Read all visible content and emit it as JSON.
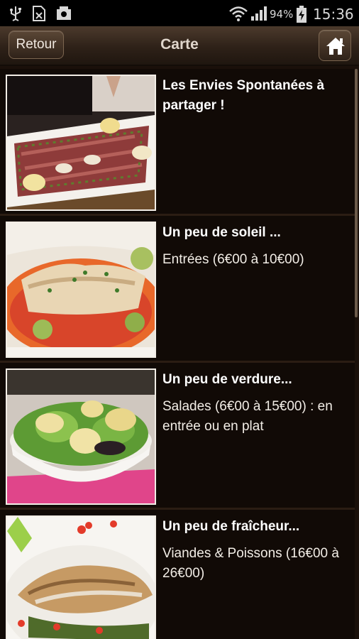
{
  "statusbar": {
    "battery": "94%",
    "time": "15:36"
  },
  "header": {
    "back_label": "Retour",
    "title": "Carte",
    "home_icon": "home-icon"
  },
  "menu": {
    "items": [
      {
        "title": "Les Envies Spontanées à partager !",
        "description": "",
        "image": "carpaccio-plate"
      },
      {
        "title": "Un peu de soleil ...",
        "description": "Entrées (6€00 à 10€00)",
        "image": "fish-vegetables-plate"
      },
      {
        "title": "Un peu de verdure...",
        "description": "Salades (6€00 à 15€00) : en entrée ou en plat",
        "image": "salad-bowl"
      },
      {
        "title": "Un peu de fraîcheur...",
        "description": "Viandes & Poissons (16€00 à 26€00)",
        "image": "grilled-fish-plate"
      }
    ]
  },
  "colors": {
    "header_top": "#4c3a2c",
    "list_bg": "#1a100a",
    "text": "#ffffff"
  }
}
